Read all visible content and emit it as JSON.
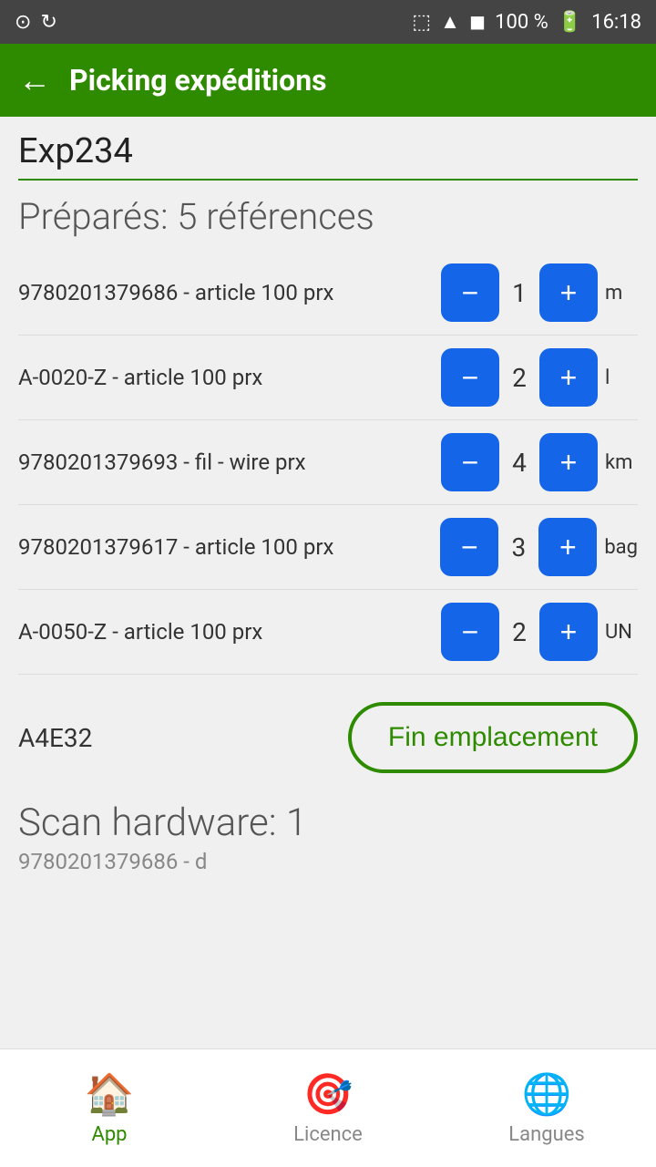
{
  "status_bar": {
    "battery": "100 %",
    "time": "16:18"
  },
  "top_bar": {
    "title": "Picking expéditions",
    "back_label": "←"
  },
  "expedition": {
    "id": "Exp234"
  },
  "section": {
    "title": "Préparés: 5 références"
  },
  "items": [
    {
      "id": 0,
      "name": "9780201379686 - article 100 prx",
      "qty": 1,
      "unit": "m"
    },
    {
      "id": 1,
      "name": "A-0020-Z - article 100 prx",
      "qty": 2,
      "unit": "l"
    },
    {
      "id": 2,
      "name": "9780201379693 - fil - wire prx",
      "qty": 4,
      "unit": "km"
    },
    {
      "id": 3,
      "name": "9780201379617 - article 100 prx",
      "qty": 3,
      "unit": "bag"
    },
    {
      "id": 4,
      "name": "A-0050-Z - article 100 prx",
      "qty": 2,
      "unit": "UN"
    }
  ],
  "action_area": {
    "location_code": "A4E32",
    "fin_button_label": "Fin emplacement"
  },
  "scan_section": {
    "title": "Scan hardware: 1",
    "detail": "9780201379686 - d"
  },
  "bottom_nav": {
    "items": [
      {
        "key": "app",
        "label": "App",
        "icon": "🏠",
        "active": true
      },
      {
        "key": "licence",
        "label": "Licence",
        "icon": "🎯",
        "active": false
      },
      {
        "key": "langues",
        "label": "Langues",
        "icon": "🌐",
        "active": false
      }
    ]
  }
}
